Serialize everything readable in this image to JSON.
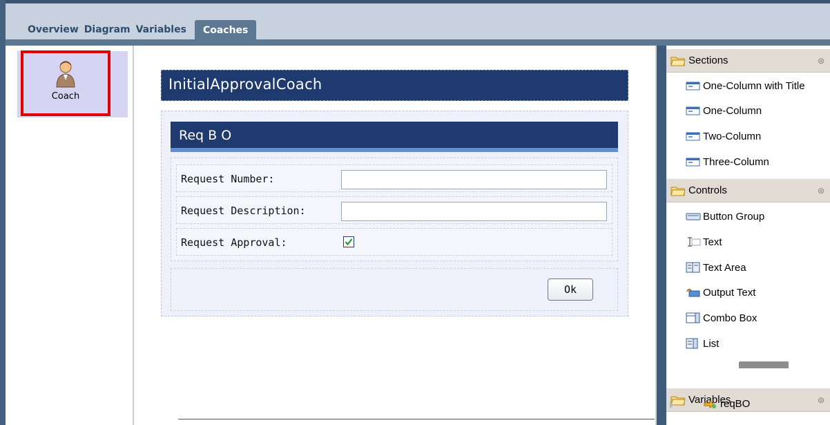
{
  "tabs": [
    {
      "label": "Overview"
    },
    {
      "label": "Diagram"
    },
    {
      "label": "Variables"
    },
    {
      "label": "Coaches",
      "active": true
    }
  ],
  "left_palette": {
    "coach_label": "Coach",
    "coach_icon": "person-icon"
  },
  "canvas": {
    "coach_title": "InitialApprovalCoach",
    "section_title": "Req B O",
    "fields": [
      {
        "label": "Request Number:",
        "type": "text",
        "value": ""
      },
      {
        "label": "Request Description:",
        "type": "text",
        "value": ""
      },
      {
        "label": "Request Approval:",
        "type": "checkbox",
        "checked": true
      }
    ],
    "ok_label": "Ok"
  },
  "palette": {
    "sections_header": "Sections",
    "sections_items": [
      {
        "label": "One-Column with Title",
        "icon": "layout-icon"
      },
      {
        "label": "One-Column",
        "icon": "layout-icon"
      },
      {
        "label": "Two-Column",
        "icon": "layout-icon"
      },
      {
        "label": "Three-Column",
        "icon": "layout-icon"
      }
    ],
    "controls_header": "Controls",
    "controls_items": [
      {
        "label": "Button Group",
        "icon": "button-group-icon"
      },
      {
        "label": "Text",
        "icon": "text-cursor-icon"
      },
      {
        "label": "Text Area",
        "icon": "text-area-icon"
      },
      {
        "label": "Output Text",
        "icon": "output-text-icon"
      },
      {
        "label": "Combo Box",
        "icon": "combo-box-icon"
      },
      {
        "label": "List",
        "icon": "list-icon"
      }
    ],
    "variables_header": "Variables",
    "variables_items": [
      {
        "label": "reqBO",
        "icon": "variable-arrow-icon"
      }
    ]
  },
  "colors": {
    "title_bar": "#1f3a6e",
    "highlight_border": "#e10000",
    "tab_active": "#5c7893"
  }
}
